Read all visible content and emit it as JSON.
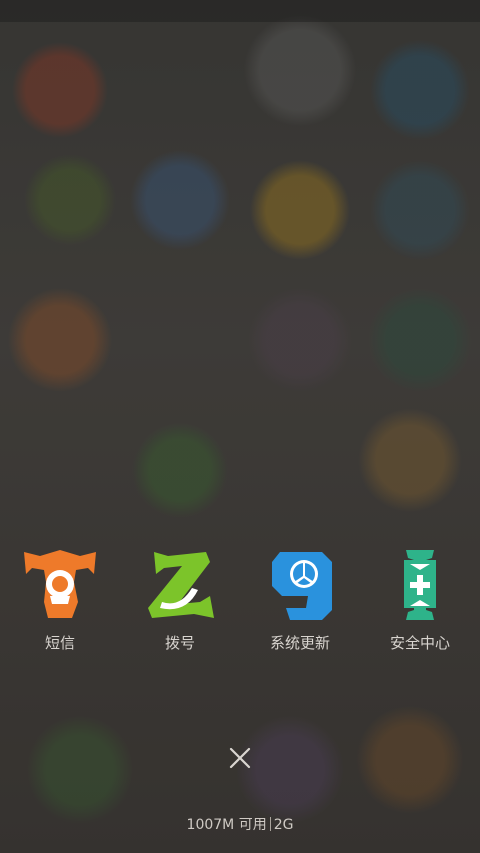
{
  "shortcuts": [
    {
      "label": "短信",
      "icon": "letter-t-sms-icon",
      "color": "#ee7a2a"
    },
    {
      "label": "拨号",
      "icon": "letter-z-dialer-icon",
      "color": "#7cc42a"
    },
    {
      "label": "系统更新",
      "icon": "letter-9-update-icon",
      "color": "#2a92dd"
    },
    {
      "label": "安全中心",
      "icon": "letter-i-security-icon",
      "color": "#2eb38a"
    }
  ],
  "close": {
    "icon": "close-icon"
  },
  "memory": {
    "available": "1007M 可用",
    "total": "2G"
  }
}
